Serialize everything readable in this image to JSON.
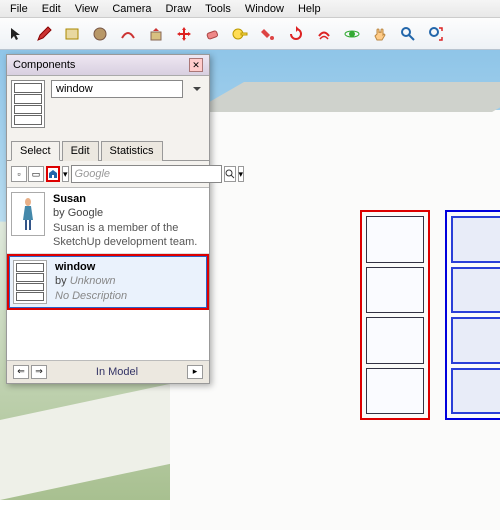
{
  "menu": [
    "File",
    "Edit",
    "View",
    "Camera",
    "Draw",
    "Tools",
    "Window",
    "Help"
  ],
  "panel": {
    "title": "Components",
    "name_value": "window",
    "tabs": {
      "select": "Select",
      "edit": "Edit",
      "stats": "Statistics"
    },
    "search_placeholder": "Google",
    "items": [
      {
        "name": "Susan",
        "author": "Google",
        "desc": "Susan is a member of the SketchUp development team.",
        "by": "by "
      },
      {
        "name": "window",
        "author": "Unknown",
        "desc": "No Description",
        "by": "by "
      }
    ],
    "footer": "In Model"
  }
}
